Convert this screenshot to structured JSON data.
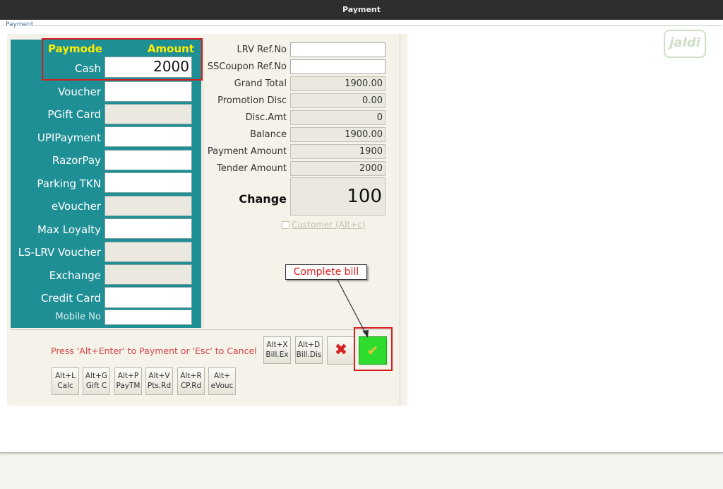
{
  "window": {
    "title": "Payment",
    "group_title": "Payment",
    "logo_text": "jaldi"
  },
  "paymodes": {
    "header_mode": "Paymode",
    "header_amount": "Amount",
    "rows": [
      {
        "label": "Cash",
        "value": "2000",
        "enabled": true
      },
      {
        "label": "Voucher",
        "value": "",
        "enabled": true
      },
      {
        "label": "PGift Card",
        "value": "",
        "enabled": false
      },
      {
        "label": "UPIPayment",
        "value": "",
        "enabled": true
      },
      {
        "label": "RazorPay",
        "value": "",
        "enabled": true
      },
      {
        "label": "Parking TKN",
        "value": "",
        "enabled": true
      },
      {
        "label": "eVoucher",
        "value": "",
        "enabled": false
      },
      {
        "label": "Max Loyalty",
        "value": "",
        "enabled": true
      },
      {
        "label": "LS-LRV Voucher",
        "value": "",
        "enabled": false
      },
      {
        "label": "Exchange",
        "value": "",
        "enabled": false
      },
      {
        "label": "Credit Card",
        "value": "",
        "enabled": true
      }
    ],
    "mobile_label": "Mobile No",
    "mobile_value": ""
  },
  "summary": {
    "lrv_label": "LRV Ref.No",
    "lrv_value": "",
    "sscoupon_label": "SSCoupon Ref.No",
    "sscoupon_value": "",
    "grand_total_label": "Grand Total",
    "grand_total_value": "1900.00",
    "promotion_label": "Promotion Disc",
    "promotion_value": "0.00",
    "disc_amt_label": "Disc.Amt",
    "disc_amt_value": "0",
    "balance_label": "Balance",
    "balance_value": "1900.00",
    "payment_amount_label": "Payment Amount",
    "payment_amount_value": "1900",
    "tender_label": "Tender Amount",
    "tender_value": "2000",
    "change_label": "Change",
    "change_value": "100",
    "customer_label": "Customer (Alt+c)"
  },
  "footer": {
    "hint": "Press 'Alt+Enter' to Payment or 'Esc' to Cancel",
    "top_keys": [
      {
        "line1": "Alt+X",
        "line2": "Bill.Ex"
      },
      {
        "line1": "Alt+D",
        "line2": "Bill.Dis"
      }
    ],
    "bottom_keys": [
      {
        "line1": "Alt+L",
        "line2": "Calc"
      },
      {
        "line1": "Alt+G",
        "line2": "Gift C"
      },
      {
        "line1": "Alt+P",
        "line2": "PayTM"
      },
      {
        "line1": "Alt+V",
        "line2": "Pts.Rd"
      },
      {
        "line1": "Alt+R",
        "line2": "CP.Rd"
      },
      {
        "line1": "Alt+",
        "line2": "eVouc"
      }
    ]
  },
  "annotation": {
    "callout": "Complete bill"
  },
  "icons": {
    "cancel": "x-icon",
    "complete": "check-icon"
  },
  "colors": {
    "panel_teal": "#1f8f96",
    "header_yellow": "#ffee00",
    "hint_red": "#d24545",
    "complete_green": "#2edc2e"
  }
}
